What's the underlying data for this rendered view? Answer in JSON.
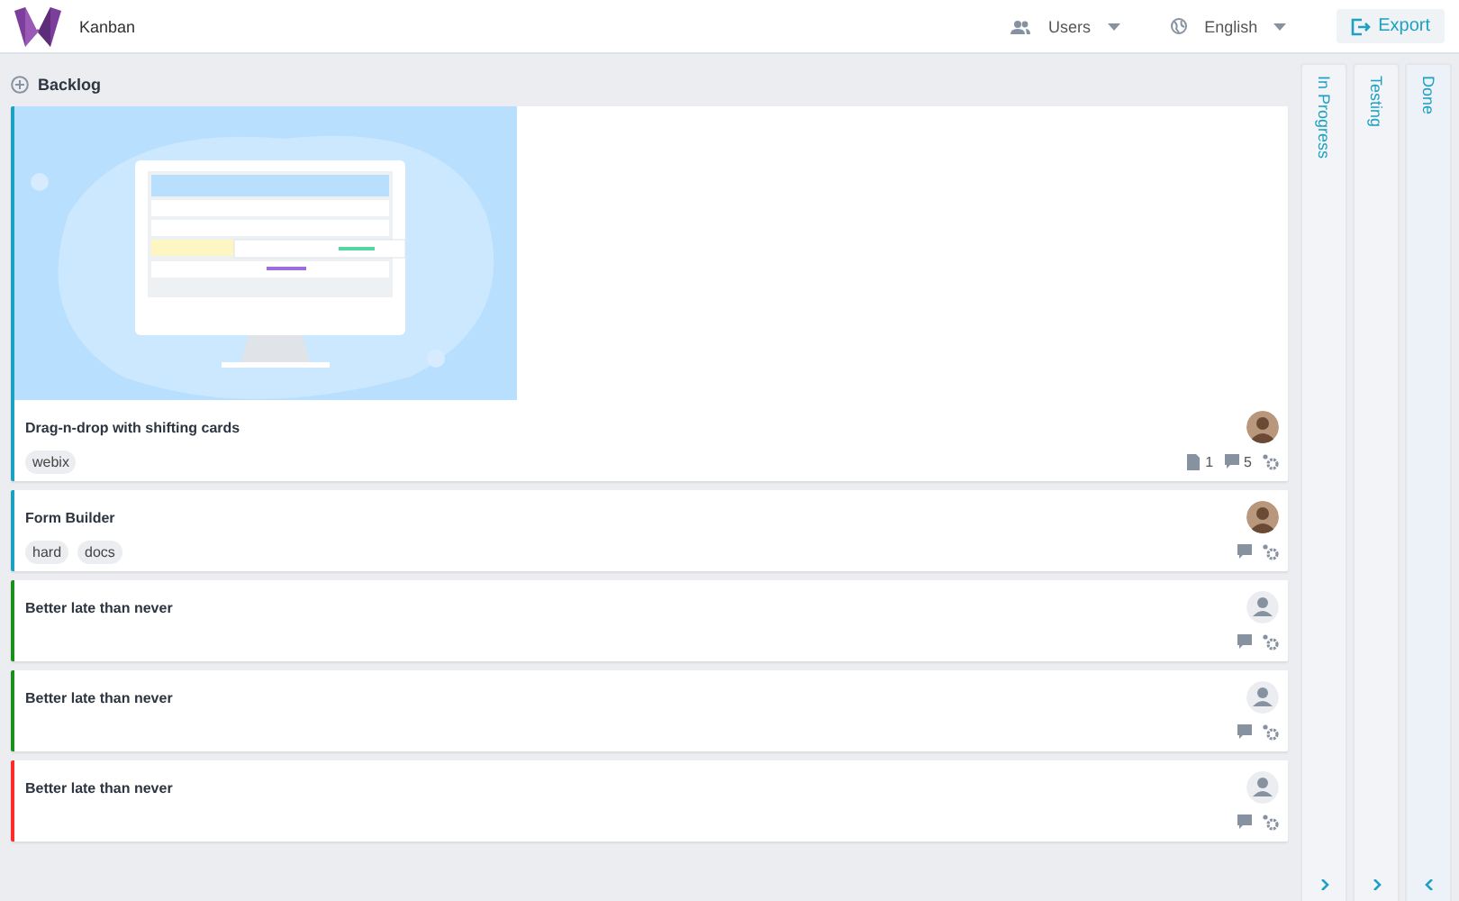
{
  "header": {
    "app_title": "Kanban",
    "users_label": "Users",
    "language": "English",
    "export_label": "Export"
  },
  "backlog": {
    "title": "Backlog",
    "cards": [
      {
        "title": "Drag-n-drop with shifting cards",
        "color": "#1ca1c1",
        "image": {
          "kind": "picture"
        },
        "tags": [
          "webix"
        ],
        "avatar_photo": true,
        "attachments": "1",
        "comments": "5"
      },
      {
        "title": "Form Builder",
        "color": "#1ca1c1",
        "tags": [
          "hard",
          "docs"
        ],
        "avatar_photo": true
      },
      {
        "title": "Better late than never",
        "color": "#1b8f1b",
        "avatar_photo": false
      },
      {
        "title": "Better late than never",
        "color": "#1b8f1b",
        "avatar_photo": false
      },
      {
        "title": "Better late than never",
        "color": "#ff2a2a",
        "avatar_photo": false
      }
    ]
  },
  "collapsed_columns": [
    {
      "title": "In Progress",
      "chevron_left": false
    },
    {
      "title": "Testing",
      "chevron_left": false
    },
    {
      "title": "Done",
      "chevron_left": true
    }
  ]
}
